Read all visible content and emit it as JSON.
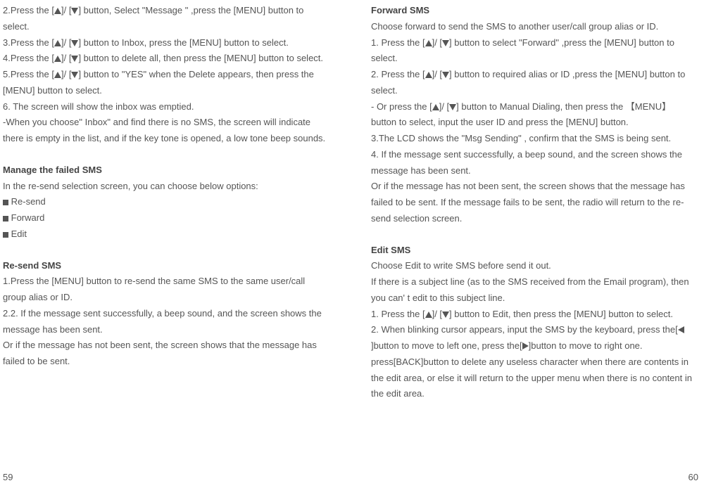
{
  "left": {
    "p1a": "2.Press the [",
    "p1b": "]/ [",
    "p1c": "] button, Select \"Message \" ,press the [MENU] button to select.",
    "p2a": "3.Press the [",
    "p2b": "]/ [",
    "p2c": "] button to Inbox, press the [MENU] button to select.",
    "p3a": "4.Press the [",
    "p3b": "]/ [",
    "p3c": "] button to delete all, then press the [MENU] button to select.",
    "p4a": "5.Press the [",
    "p4b": "]/ [",
    "p4c": "] button to \"YES\" when the Delete appears, then press the [MENU] button to select.",
    "p5": "6. The screen will show the inbox was emptied.",
    "p6": "-When you choose\" Inbox\" and find there is no SMS, the screen will indicate there is empty in the list, and if the key tone is opened, a low tone beep sounds.",
    "h1": "Manage the failed SMS",
    "p7": " In the re-send selection screen, you can choose below options:",
    "b1": "Re-send",
    "b2": "Forward",
    "b3": "Edit",
    "h2": "Re-send SMS",
    "p8": "1.Press the [MENU] button to re-send the same SMS to the same user/call group alias or ID.",
    "p9": "2.2. If the message sent successfully, a beep sound, and the screen shows the message has been sent.",
    "p10": "Or if the message has not been sent, the screen shows that the message has failed to be sent."
  },
  "right": {
    "h1": "Forward SMS",
    "p1": "Choose forward to send the SMS to another user/call group alias or ID.",
    "p2a": "1. Press the [",
    "p2b": "]/ [",
    "p2c": "] button to select \"Forward\" ,press the [MENU] button to select.",
    "p3a": "2. Press the [",
    "p3b": "]/ [",
    "p3c": "] button to required alias or ID ,press the [MENU] button to select.",
    "p4a": "- Or press the [",
    "p4b": "]/ [",
    "p4c": "] button to Manual Dialing, then press the 【MENU】 button to select, input the user ID and press the [MENU] button.",
    "p5": "3.The LCD shows the \"Msg Sending\" , confirm that the SMS is being sent.",
    "p6": "4. If the message sent successfully, a beep sound, and the screen shows the message has been sent.",
    "p7": "Or if the message has not been sent, the screen shows that the message has failed to be sent. If the message fails to be sent, the radio will return to the re-send selection screen.",
    "h2": "Edit SMS",
    "p8": "Choose Edit to write SMS before send it out.",
    "p9": "If there is a subject line (as to the SMS received from the Email program), then you can' t edit to this subject line.",
    "p10a": "1. Press the [",
    "p10b": "]/ [",
    "p10c": "] button to Edit, then press the [MENU] button to select.",
    "p11a": "2. When blinking cursor appears, input the SMS by the keyboard, press the[",
    "p11b": "]button to move to left one, press the[",
    "p11c": "]button to move to right one. press[BACK]button to delete any useless character when there are contents in the edit area, or else it will return to the upper menu when there is no content in the edit area."
  },
  "footer": {
    "left": "59",
    "right": "60"
  }
}
